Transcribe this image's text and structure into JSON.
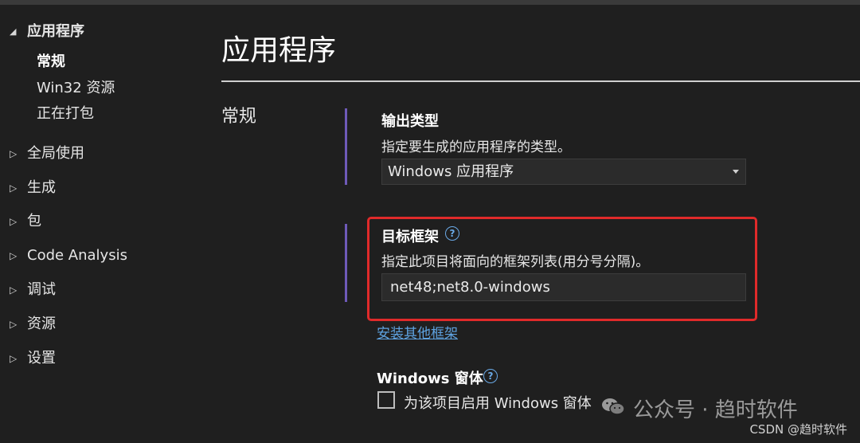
{
  "sidebar": {
    "items": [
      {
        "label": "应用程序",
        "expanded": true,
        "children": [
          {
            "label": "常规",
            "selected": true
          },
          {
            "label": "Win32 资源"
          },
          {
            "label": "正在打包"
          }
        ]
      },
      {
        "label": "全局使用"
      },
      {
        "label": "生成"
      },
      {
        "label": "包"
      },
      {
        "label": "Code Analysis"
      },
      {
        "label": "调试"
      },
      {
        "label": "资源"
      },
      {
        "label": "设置"
      }
    ],
    "arrow_expanded": "◢",
    "arrow_collapsed": "▷"
  },
  "main": {
    "title": "应用程序",
    "section": "常规",
    "output_type": {
      "heading": "输出类型",
      "description": "指定要生成的应用程序的类型。",
      "value": "Windows 应用程序"
    },
    "target_framework": {
      "heading": "目标框架",
      "help_icon": "?",
      "description": "指定此项目将面向的框架列表(用分号分隔)。",
      "value": "net48;net8.0-windows"
    },
    "install_link": "安装其他框架",
    "windows_forms": {
      "heading": "Windows 窗体",
      "help_icon": "?",
      "checkbox_label": "为该项目启用 Windows 窗体",
      "checked": false
    }
  },
  "watermark": {
    "text": "公众号 · 趋时软件",
    "credit": "CSDN @趋时软件"
  },
  "colors": {
    "background": "#1f1f1f",
    "accent_bar": "#6e5ab8",
    "highlight_box": "#e02a2a",
    "link": "#5ea2e0",
    "help_icon": "#6aa9e6"
  }
}
